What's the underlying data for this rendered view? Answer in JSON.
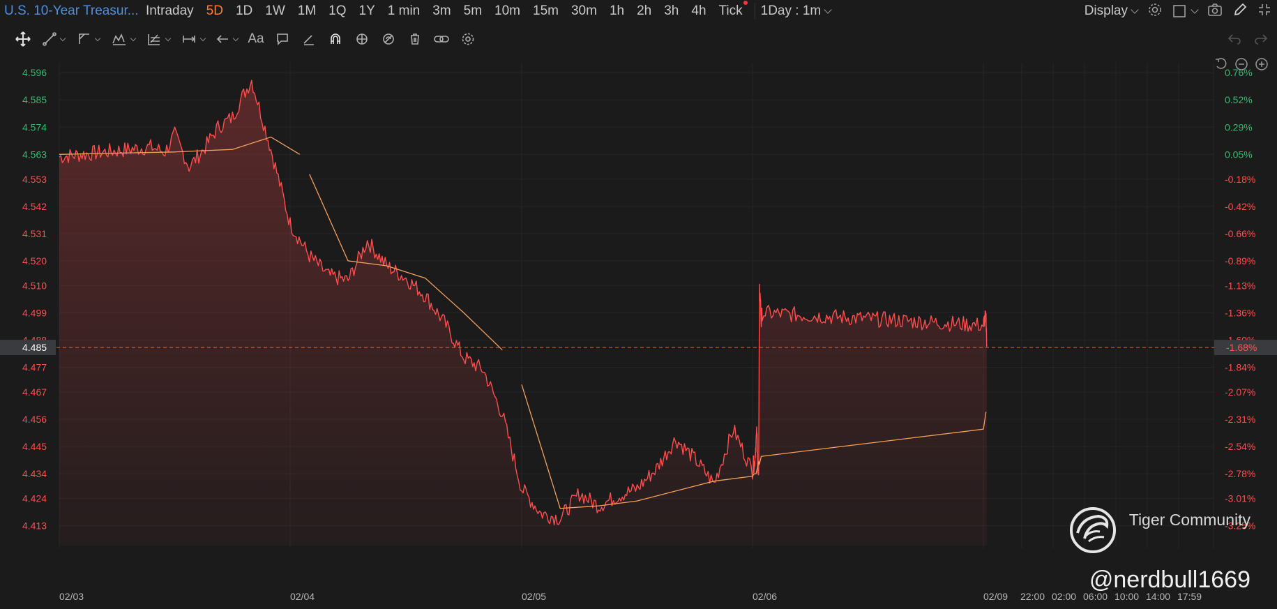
{
  "header": {
    "ticker": "U.S. 10-Year Treasur...",
    "periods": [
      "Intraday",
      "5D",
      "1D",
      "1W",
      "1M",
      "1Q",
      "1Y",
      "1 min",
      "3m",
      "5m",
      "10m",
      "15m",
      "30m",
      "1h",
      "2h",
      "3h",
      "4h",
      "Tick"
    ],
    "active_period": "5D",
    "interval": "1Day : 1m",
    "display_label": "Display"
  },
  "icons": {
    "top_right": [
      "settings-icon",
      "square-icon",
      "camera-icon",
      "pencil-icon",
      "fullscreen-icon"
    ],
    "toolbar": [
      "move-icon",
      "line-tool-icon",
      "shape-tool-icon",
      "pattern-tool-icon",
      "fib-tool-icon",
      "measure-tool-icon",
      "arrow-tool-icon",
      "text-tool-icon",
      "comment-tool-icon",
      "eraser-icon",
      "magnet-icon",
      "lock-icon",
      "hide-icon",
      "trash-icon",
      "link-icon",
      "gear-icon",
      "undo-icon",
      "redo-icon"
    ],
    "zoom": [
      "reset-icon",
      "zoom-out-icon",
      "zoom-in-icon"
    ]
  },
  "colors": {
    "background": "#1b1b1c",
    "price_line": "#ff4d4d",
    "ma_line": "#f5a05a",
    "up_axis_text": "#2dbd6e",
    "down_axis_text": "#ff4d4d",
    "active": "#ff7a2b",
    "ticker": "#4f8fe0"
  },
  "chart_data": {
    "type": "line",
    "series": [
      {
        "x": [
          "02/03 start",
          "02/03 09:30",
          "02/03 11:00",
          "02/03 12:00",
          "02/03 13:30",
          "02/03 15:00",
          "02/03 16:30",
          "02/03 18:00",
          "02/03 19:00",
          "02/03 20:00",
          "02/03 22:00",
          "02/04 00:00",
          "02/04 02:00",
          "02/04 04:00",
          "02/04 06:00",
          "02/04 08:00",
          "02/04 10:00",
          "02/04 12:00",
          "02/04 14:00",
          "02/04 16:00",
          "02/04 18:00",
          "02/04 20:00",
          "02/04 22:00",
          "02/05 00:00",
          "02/05 02:00",
          "02/05 04:00",
          "02/05 06:00",
          "02/05 08:00",
          "02/05 10:00",
          "02/05 12:00",
          "02/05 14:00",
          "02/05 16:00",
          "02/05 18:00",
          "02/05 20:00",
          "02/05 22:00",
          "02/06 00:00",
          "02/06 02:00",
          "02/06 04:00",
          "02/06 06:00",
          "02/06 08:00",
          "02/06 10:00",
          "02/06 12:00",
          "02/06 14:00",
          "02/06 16:00",
          "02/06 18:00",
          "02/06 20:00",
          "02/06 22:00",
          "02/09 00:00",
          "02/09 02:00",
          "02/09 04:00",
          "02/09 06:00",
          "02/09 08:00"
        ],
        "values": [
          4.562,
          4.566,
          4.564,
          4.571,
          4.558,
          4.565,
          4.574,
          4.578,
          4.586,
          4.593,
          4.565,
          4.535,
          4.522,
          4.514,
          4.512,
          4.528,
          4.518,
          4.513,
          4.506,
          4.495,
          4.481,
          4.476,
          4.458,
          4.428,
          4.418,
          4.416,
          4.426,
          4.421,
          4.425,
          4.428,
          4.436,
          4.448,
          4.44,
          4.43,
          4.452,
          4.435,
          4.438,
          4.437,
          4.442,
          4.447,
          4.451,
          4.438,
          4.432,
          4.508,
          4.505,
          4.495,
          4.499,
          4.494,
          4.496,
          4.497,
          4.496,
          4.486
        ]
      },
      {
        "x": [
          "02/03 start",
          "02/03 12:00",
          "02/03 18:00",
          "02/03 22:00",
          "02/04 01:00",
          "02/04 02:00",
          "02/04 06:00",
          "02/04 10:00",
          "02/04 14:00",
          "02/04 18:00",
          "02/04 22:00",
          "02/05 00:00",
          "02/05 04:00",
          "02/05 08:00",
          "02/05 12:00",
          "02/05 16:00",
          "02/05 20:00",
          "02/06 00:00",
          "02/06 04:00",
          "02/06 08:00",
          "02/06 12:00",
          "02/06 14:00",
          "02/06 16:00",
          "02/06 20:00",
          "02/09 00:00",
          "02/09 06:00"
        ],
        "values": [
          4.563,
          4.564,
          4.565,
          4.57,
          4.563,
          4.555,
          4.52,
          4.518,
          4.513,
          4.499,
          4.484,
          4.47,
          4.42,
          4.421,
          4.423,
          4.427,
          4.431,
          4.433,
          4.434,
          4.434,
          4.437,
          4.439,
          4.438,
          4.441,
          4.452,
          4.459
        ]
      }
    ],
    "ylim": [
      4.405,
      4.6
    ],
    "y_ticks": [
      "4.596",
      "4.585",
      "4.574",
      "4.563",
      "4.553",
      "4.542",
      "4.531",
      "4.520",
      "4.510",
      "4.499",
      "4.488",
      "4.477",
      "4.467",
      "4.456",
      "4.445",
      "4.434",
      "4.424",
      "4.413"
    ],
    "y_tick_values": [
      4.596,
      4.585,
      4.574,
      4.563,
      4.553,
      4.542,
      4.531,
      4.52,
      4.51,
      4.499,
      4.488,
      4.477,
      4.467,
      4.456,
      4.445,
      4.434,
      4.424,
      4.413
    ],
    "pct_ticks": [
      "0.76%",
      "0.52%",
      "0.29%",
      "0.05%",
      "-0.18%",
      "-0.42%",
      "-0.66%",
      "-0.89%",
      "-1.13%",
      "-1.36%",
      "-1.60%",
      "-1.84%",
      "-2.07%",
      "-2.31%",
      "-2.54%",
      "-2.78%",
      "-3.01%",
      "-3.25%"
    ],
    "current_price": {
      "value": 4.485,
      "label": "4.485",
      "pct": "-1.68%"
    },
    "x_day_labels": [
      "02/03",
      "02/04",
      "02/05",
      "02/06",
      "02/09"
    ],
    "x_time_labels": [
      "22:00",
      "02:00",
      "06:00",
      "10:00",
      "14:00",
      "17:59"
    ],
    "grid": true
  },
  "watermark": {
    "community": "Tiger Community",
    "user": "@nerdbull1669"
  }
}
